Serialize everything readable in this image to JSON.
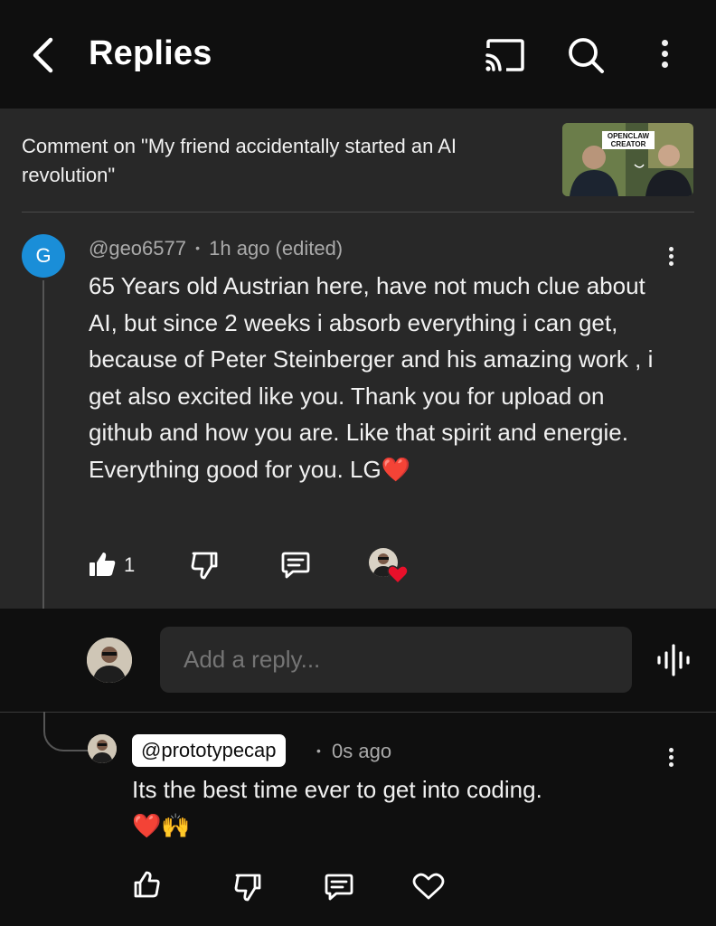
{
  "header": {
    "title": "Replies",
    "icons": [
      "back-arrow-icon",
      "cast-icon",
      "search-icon",
      "more-vertical-icon"
    ]
  },
  "context": {
    "text": "Comment on \"My friend accidentally started an AI revolution\"",
    "thumbnail_caption": "OPENCLAW CREATOR"
  },
  "comment": {
    "avatar_letter": "G",
    "author": "@geo6577",
    "separator": "•",
    "time": "1h ago (edited)",
    "text": "65 Years old Austrian here, have not much clue about AI, but since 2 weeks i absorb everything i can get, because of Peter Steinberger and his amazing work , i get also excited like you. Thank you for upload on github and how you are. Like that spirit and energie. Everything good for you. LG❤️",
    "like_count": "1",
    "actions": [
      "like-filled-icon",
      "dislike-icon",
      "reply-icon",
      "creator-heart-badge"
    ]
  },
  "reply_box": {
    "placeholder": "Add a reply...",
    "icons": [
      "voice-input-icon"
    ]
  },
  "reply": {
    "author": "@prototypecap",
    "separator": "•",
    "time": "0s ago",
    "text_line1": "Its the best time ever to get into coding.",
    "text_line2": "❤️🙌",
    "actions": [
      "like-icon",
      "dislike-icon",
      "reply-icon",
      "heart-icon"
    ]
  },
  "colors": {
    "background": "#0f0f0f",
    "panel": "#282828",
    "secondary_text": "#aaaaaa",
    "avatar_blue": "#1a8ed8",
    "heart_red": "#e8102a"
  }
}
